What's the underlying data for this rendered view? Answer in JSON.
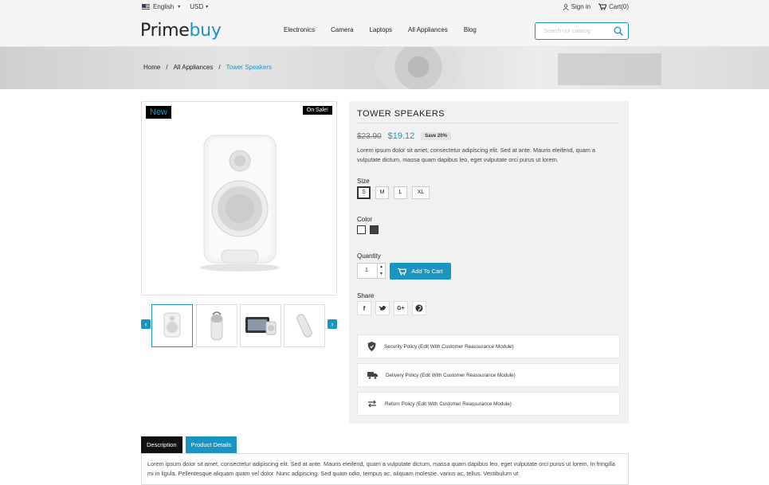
{
  "header": {
    "language": "English",
    "currency": "USD",
    "sign_in": "Sign in",
    "cart": "Cart(0)",
    "logo_part1": "Prime",
    "logo_part2": "buy",
    "nav": [
      "Electronics",
      "Camera",
      "Laptops",
      "All Appliances",
      "Blog"
    ],
    "search_placeholder": "Search our catalog"
  },
  "breadcrumb": [
    "Home",
    "All Appliances",
    "Tower Speakers"
  ],
  "product": {
    "badge_new": "New",
    "badge_sale": "On Sale!",
    "title": "TOWER SPEAKERS",
    "old_price": "$23.90",
    "price": "$19.12",
    "discount": "Save 20%",
    "short_description": "Lorem ipsum dolor sit amet, consectetur adipiscing elit. Sed at ante. Mauris eleifend, quam a vulputate dictum, massa quam dapibus leo, eget vulputate orci purus ut lorem.",
    "size_label": "Size",
    "sizes": [
      "S",
      "M",
      "L",
      "XL"
    ],
    "selected_size": "S",
    "color_label": "Color",
    "colors": [
      "#ffffff",
      "#3d4147"
    ],
    "quantity_label": "Quantity",
    "quantity": "1",
    "add_to_cart": "Add To Cart",
    "share_label": "Share",
    "share": [
      "facebook-icon",
      "twitter-icon",
      "google-plus-icon",
      "pinterest-icon"
    ],
    "policies": [
      "Security Policy (Edit With Customer Reassurance Module)",
      "Delivery Policy (Edit With Customer Reassurance Module)",
      "Return Policy (Edit With Customer Reassurance Module)"
    ]
  },
  "tabs": {
    "items": [
      "Description",
      "Product Details"
    ],
    "active": "Product Details",
    "body": "Lorem ipsum dolor sit amet, consectetur adipiscing elit. Sed at ante. Mauris eleifend, quam a vulputate dictum, massa quam dapibus leo, eget vulputate orci purus ut lorem. In fringilla mi in ligula. Pellentesque aliquam quam vel dolor. Nunc adipiscing. Sed quam odio, tempus ac, aliquam molestie, varius ac, tellus. Vestibulum ut"
  },
  "colors": {
    "accent": "#1a95c2",
    "dark": "#111111"
  }
}
